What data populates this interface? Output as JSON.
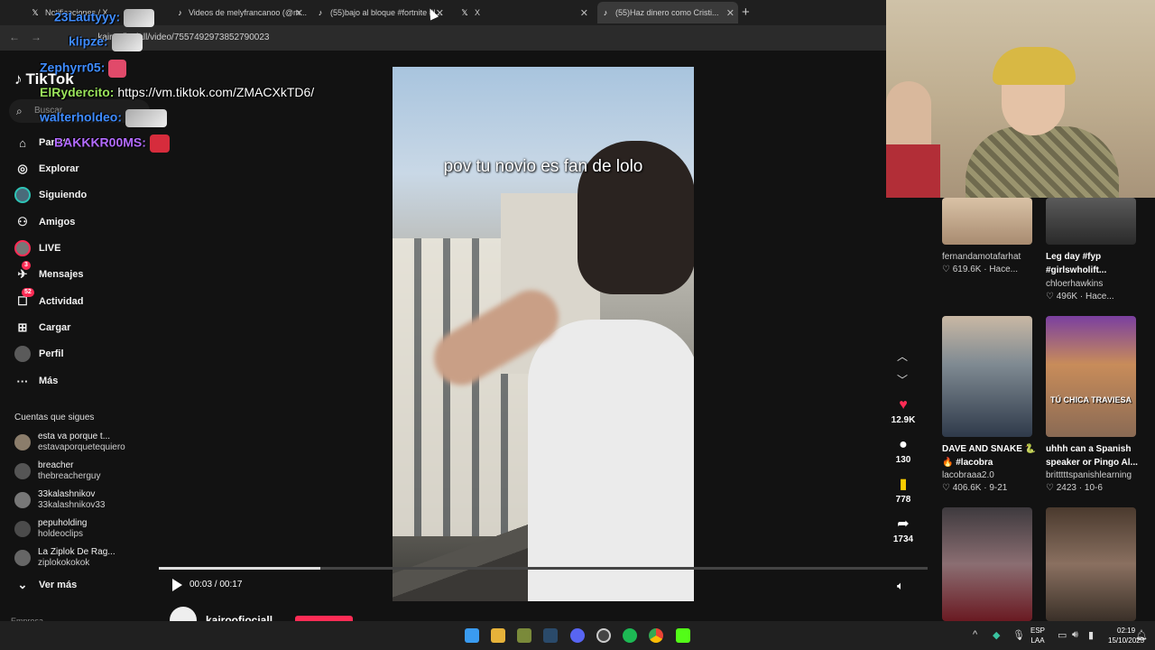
{
  "browser": {
    "tabs": [
      {
        "label": "Notificaciones / X",
        "favicon": "x"
      },
      {
        "label": "Videos de melyfrancanoo (@m...",
        "favicon": "tiktok"
      },
      {
        "label": "(55)bajo al bloque #fortnite #l...",
        "favicon": "tiktok"
      },
      {
        "label": "X",
        "favicon": "x"
      },
      {
        "label": "(55)Haz dinero como Cristi...",
        "favicon": "tiktok"
      }
    ],
    "new_tab": "+",
    "url": "...kairoofiociall/video/7557492973852790023"
  },
  "chat": [
    {
      "user": "23Lautyyy:",
      "text": "",
      "color": "#3f8cff"
    },
    {
      "user": "klipze:",
      "text": "",
      "color": "#3f8cff"
    },
    {
      "user": "Zephyrr05:",
      "text": "",
      "color": "#3f8cff"
    },
    {
      "user": "ElRydercito:",
      "text": "https://vm.tiktok.com/ZMACXkTD6/",
      "color": "#9be55b"
    },
    {
      "user": "walterholdeo:",
      "text": "",
      "color": "#3f8cff"
    },
    {
      "user": "BAKKKR00MS:",
      "text": "",
      "color": "#b36bff"
    }
  ],
  "sidebar": {
    "logo": "TikTok",
    "search_placeholder": "Buscar",
    "nav": [
      {
        "label": "Para ti",
        "icon": "home-icon",
        "glyph": "⌂"
      },
      {
        "label": "Explorar",
        "icon": "compass-icon",
        "glyph": "◎"
      },
      {
        "label": "Siguiendo",
        "icon": "following-avatar-icon",
        "glyph": "●"
      },
      {
        "label": "Amigos",
        "icon": "friends-icon",
        "glyph": "⚇"
      },
      {
        "label": "LIVE",
        "icon": "live-avatar-icon",
        "glyph": "●"
      },
      {
        "label": "Mensajes",
        "icon": "messages-icon",
        "glyph": "✈",
        "badge": "3"
      },
      {
        "label": "Actividad",
        "icon": "activity-icon",
        "glyph": "☐",
        "badge": "52"
      },
      {
        "label": "Cargar",
        "icon": "upload-icon",
        "glyph": "⊞"
      },
      {
        "label": "Perfil",
        "icon": "profile-avatar-icon",
        "glyph": "●"
      },
      {
        "label": "Más",
        "icon": "more-icon",
        "glyph": "···"
      }
    ],
    "following_title": "Cuentas que sigues",
    "following": [
      {
        "name": "esta va porque t...",
        "handle": "estavaporquetequiero"
      },
      {
        "name": "breacher",
        "handle": "thebreacherguy"
      },
      {
        "name": "33kalashnikov",
        "handle": "33kalashnikov33"
      },
      {
        "name": "pepuholding",
        "handle": "holdeoclips"
      },
      {
        "name": "La Ziplok De Rag...",
        "handle": "ziplokokokok"
      }
    ],
    "see_more": "Ver más",
    "footer": "Empresa"
  },
  "video": {
    "caption": "pov tu novio es fan de lolo",
    "time": "00:03 / 00:17",
    "progress": 0.21,
    "author": "kairoofiociall"
  },
  "actions": [
    {
      "icon": "heart-icon",
      "glyph": "♥",
      "count": "12.9K",
      "color": "#fe2c55"
    },
    {
      "icon": "comment-icon",
      "glyph": "●",
      "count": "130",
      "color": "#ffffff"
    },
    {
      "icon": "bookmark-icon",
      "glyph": "▮",
      "count": "778",
      "color": "#facd00"
    },
    {
      "icon": "share-icon",
      "glyph": "➦",
      "count": "1734",
      "color": "#ffffff"
    }
  ],
  "recommended": [
    {
      "title": "",
      "author": "fernandamotafarhat",
      "stats": "♡ 619.6K · Hace..."
    },
    {
      "title": "Leg day #fyp #girlswholift...",
      "author": "chloerhawkins",
      "stats": "♡ 496K · Hace..."
    },
    {
      "title": "DAVE AND SNAKE 🐍 🔥 #lacobra",
      "author": "lacobraaa2.0",
      "stats": "♡ 406.6K · 9-21"
    },
    {
      "title": "uhhh can a Spanish speaker or Pingo Al...",
      "author": "britttttspanishlearning",
      "stats": "♡ 2423 · 10-6"
    }
  ],
  "thumb_text": {
    "chica": "TÚ CHICA TRAVIESA"
  },
  "taskbar": {
    "lang_top": "ESP",
    "lang_bottom": "LAA",
    "time": "02:19",
    "date": "15/10/2025"
  }
}
